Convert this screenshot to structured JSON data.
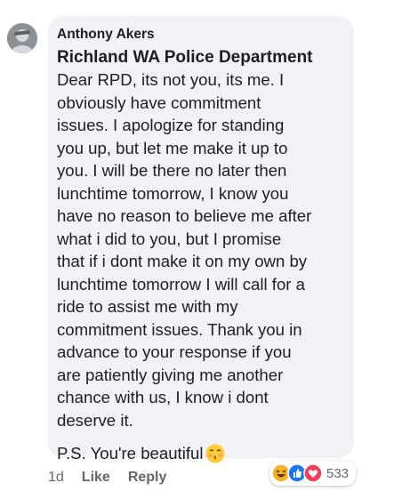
{
  "comment": {
    "author": "Anthony Akers",
    "tag": "Richland WA Police Department",
    "body": "Dear RPD, its not you, its me. I\nobviously have commitment\nissues. I apologize for standing\nyou up, but let me make it up to\nyou. I will be there no later then\nlunchtime tomorrow, I know you\nhave no reason to believe me after\nwhat i did to you, but I promise\nthat if i dont make it on my own by\nlunchtime tomorrow I will call for a\nride to assist me with my\ncommitment issues. Thank you in\nadvance to your response if you\nare patiently giving me another\nchance with us, I know i dont\ndeserve it.",
    "ps": "P.S. You're beautiful",
    "ps_emoji": "kissing-face-icon"
  },
  "actions": {
    "time": "1d",
    "like": "Like",
    "reply": "Reply"
  },
  "reactions": {
    "icons": [
      "haha-icon",
      "like-icon",
      "love-icon"
    ],
    "count": "533",
    "colors": {
      "haha": "#f7b125",
      "like": "#1877f2",
      "love": "#f33e58"
    }
  }
}
